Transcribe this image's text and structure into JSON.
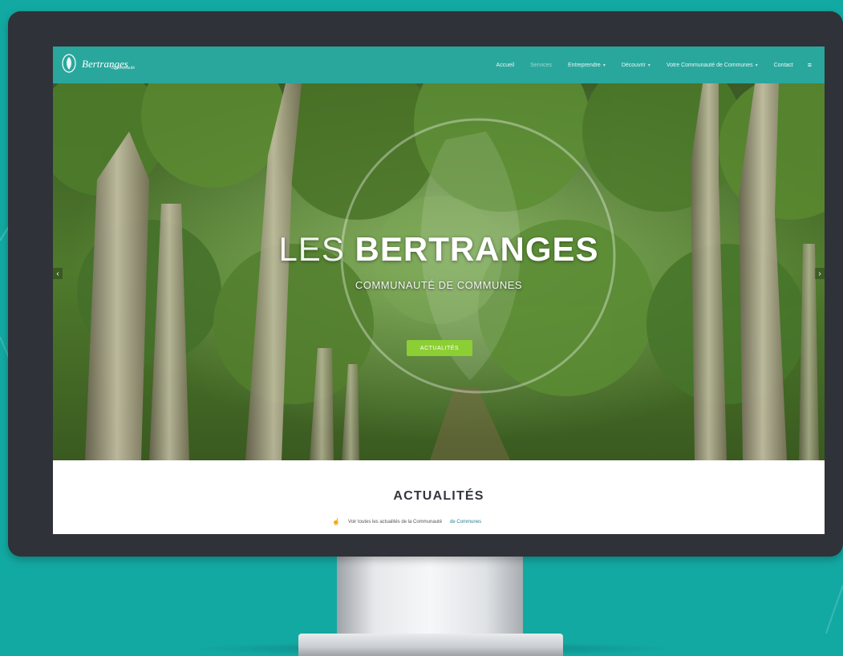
{
  "colors": {
    "background": "#13a9a3",
    "navbar": "#29a79d",
    "button": "#8ccf34",
    "monitor_bezel": "#2f3238"
  },
  "site": {
    "logo_text": "Bertranges",
    "logo_subtext": "Communauté",
    "logo_icon": "leaf-logo-icon"
  },
  "nav": {
    "items": [
      {
        "label": "Accueil",
        "active": false,
        "dropdown": false
      },
      {
        "label": "Services",
        "active": true,
        "dropdown": false
      },
      {
        "label": "Entreprendre",
        "active": false,
        "dropdown": true
      },
      {
        "label": "Découvrir",
        "active": false,
        "dropdown": true
      },
      {
        "label": "Votre Communauté de Communes",
        "active": false,
        "dropdown": true
      },
      {
        "label": "Contact",
        "active": false,
        "dropdown": false
      }
    ],
    "search_icon": "search-icon"
  },
  "hero": {
    "title_thin": "LES",
    "title_bold": "BERTRANGES",
    "subtitle": "COMMUNAUTÉ DE COMMUNES",
    "button_label": "ACTUALITÉS",
    "prev_icon": "chevron-left-icon",
    "next_icon": "chevron-right-icon"
  },
  "news": {
    "title": "ACTUALITÉS",
    "intro_text": "Voir toutes les actualités de la Communauté",
    "intro_link": "de Communes"
  }
}
